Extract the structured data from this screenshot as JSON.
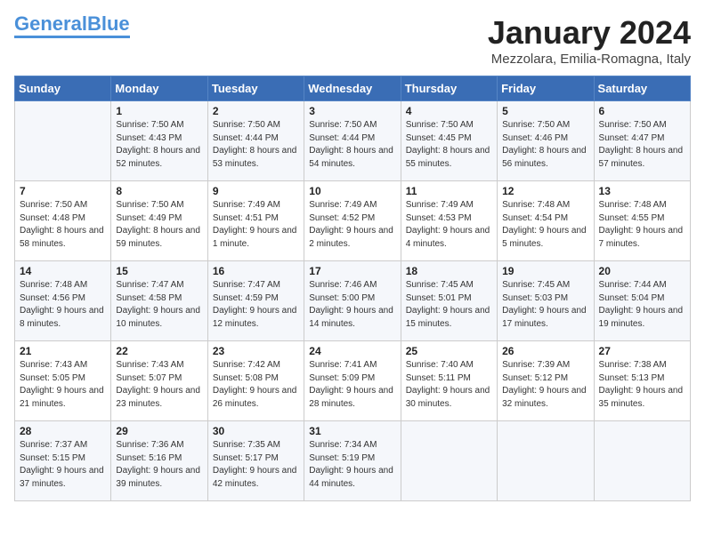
{
  "logo": {
    "part1": "General",
    "part2": "Blue"
  },
  "title": "January 2024",
  "location": "Mezzolara, Emilia-Romagna, Italy",
  "weekdays": [
    "Sunday",
    "Monday",
    "Tuesday",
    "Wednesday",
    "Thursday",
    "Friday",
    "Saturday"
  ],
  "weeks": [
    [
      {
        "day": "",
        "sunrise": "",
        "sunset": "",
        "daylight": ""
      },
      {
        "day": "1",
        "sunrise": "Sunrise: 7:50 AM",
        "sunset": "Sunset: 4:43 PM",
        "daylight": "Daylight: 8 hours and 52 minutes."
      },
      {
        "day": "2",
        "sunrise": "Sunrise: 7:50 AM",
        "sunset": "Sunset: 4:44 PM",
        "daylight": "Daylight: 8 hours and 53 minutes."
      },
      {
        "day": "3",
        "sunrise": "Sunrise: 7:50 AM",
        "sunset": "Sunset: 4:44 PM",
        "daylight": "Daylight: 8 hours and 54 minutes."
      },
      {
        "day": "4",
        "sunrise": "Sunrise: 7:50 AM",
        "sunset": "Sunset: 4:45 PM",
        "daylight": "Daylight: 8 hours and 55 minutes."
      },
      {
        "day": "5",
        "sunrise": "Sunrise: 7:50 AM",
        "sunset": "Sunset: 4:46 PM",
        "daylight": "Daylight: 8 hours and 56 minutes."
      },
      {
        "day": "6",
        "sunrise": "Sunrise: 7:50 AM",
        "sunset": "Sunset: 4:47 PM",
        "daylight": "Daylight: 8 hours and 57 minutes."
      }
    ],
    [
      {
        "day": "7",
        "sunrise": "Sunrise: 7:50 AM",
        "sunset": "Sunset: 4:48 PM",
        "daylight": "Daylight: 8 hours and 58 minutes."
      },
      {
        "day": "8",
        "sunrise": "Sunrise: 7:50 AM",
        "sunset": "Sunset: 4:49 PM",
        "daylight": "Daylight: 8 hours and 59 minutes."
      },
      {
        "day": "9",
        "sunrise": "Sunrise: 7:49 AM",
        "sunset": "Sunset: 4:51 PM",
        "daylight": "Daylight: 9 hours and 1 minute."
      },
      {
        "day": "10",
        "sunrise": "Sunrise: 7:49 AM",
        "sunset": "Sunset: 4:52 PM",
        "daylight": "Daylight: 9 hours and 2 minutes."
      },
      {
        "day": "11",
        "sunrise": "Sunrise: 7:49 AM",
        "sunset": "Sunset: 4:53 PM",
        "daylight": "Daylight: 9 hours and 4 minutes."
      },
      {
        "day": "12",
        "sunrise": "Sunrise: 7:48 AM",
        "sunset": "Sunset: 4:54 PM",
        "daylight": "Daylight: 9 hours and 5 minutes."
      },
      {
        "day": "13",
        "sunrise": "Sunrise: 7:48 AM",
        "sunset": "Sunset: 4:55 PM",
        "daylight": "Daylight: 9 hours and 7 minutes."
      }
    ],
    [
      {
        "day": "14",
        "sunrise": "Sunrise: 7:48 AM",
        "sunset": "Sunset: 4:56 PM",
        "daylight": "Daylight: 9 hours and 8 minutes."
      },
      {
        "day": "15",
        "sunrise": "Sunrise: 7:47 AM",
        "sunset": "Sunset: 4:58 PM",
        "daylight": "Daylight: 9 hours and 10 minutes."
      },
      {
        "day": "16",
        "sunrise": "Sunrise: 7:47 AM",
        "sunset": "Sunset: 4:59 PM",
        "daylight": "Daylight: 9 hours and 12 minutes."
      },
      {
        "day": "17",
        "sunrise": "Sunrise: 7:46 AM",
        "sunset": "Sunset: 5:00 PM",
        "daylight": "Daylight: 9 hours and 14 minutes."
      },
      {
        "day": "18",
        "sunrise": "Sunrise: 7:45 AM",
        "sunset": "Sunset: 5:01 PM",
        "daylight": "Daylight: 9 hours and 15 minutes."
      },
      {
        "day": "19",
        "sunrise": "Sunrise: 7:45 AM",
        "sunset": "Sunset: 5:03 PM",
        "daylight": "Daylight: 9 hours and 17 minutes."
      },
      {
        "day": "20",
        "sunrise": "Sunrise: 7:44 AM",
        "sunset": "Sunset: 5:04 PM",
        "daylight": "Daylight: 9 hours and 19 minutes."
      }
    ],
    [
      {
        "day": "21",
        "sunrise": "Sunrise: 7:43 AM",
        "sunset": "Sunset: 5:05 PM",
        "daylight": "Daylight: 9 hours and 21 minutes."
      },
      {
        "day": "22",
        "sunrise": "Sunrise: 7:43 AM",
        "sunset": "Sunset: 5:07 PM",
        "daylight": "Daylight: 9 hours and 23 minutes."
      },
      {
        "day": "23",
        "sunrise": "Sunrise: 7:42 AM",
        "sunset": "Sunset: 5:08 PM",
        "daylight": "Daylight: 9 hours and 26 minutes."
      },
      {
        "day": "24",
        "sunrise": "Sunrise: 7:41 AM",
        "sunset": "Sunset: 5:09 PM",
        "daylight": "Daylight: 9 hours and 28 minutes."
      },
      {
        "day": "25",
        "sunrise": "Sunrise: 7:40 AM",
        "sunset": "Sunset: 5:11 PM",
        "daylight": "Daylight: 9 hours and 30 minutes."
      },
      {
        "day": "26",
        "sunrise": "Sunrise: 7:39 AM",
        "sunset": "Sunset: 5:12 PM",
        "daylight": "Daylight: 9 hours and 32 minutes."
      },
      {
        "day": "27",
        "sunrise": "Sunrise: 7:38 AM",
        "sunset": "Sunset: 5:13 PM",
        "daylight": "Daylight: 9 hours and 35 minutes."
      }
    ],
    [
      {
        "day": "28",
        "sunrise": "Sunrise: 7:37 AM",
        "sunset": "Sunset: 5:15 PM",
        "daylight": "Daylight: 9 hours and 37 minutes."
      },
      {
        "day": "29",
        "sunrise": "Sunrise: 7:36 AM",
        "sunset": "Sunset: 5:16 PM",
        "daylight": "Daylight: 9 hours and 39 minutes."
      },
      {
        "day": "30",
        "sunrise": "Sunrise: 7:35 AM",
        "sunset": "Sunset: 5:17 PM",
        "daylight": "Daylight: 9 hours and 42 minutes."
      },
      {
        "day": "31",
        "sunrise": "Sunrise: 7:34 AM",
        "sunset": "Sunset: 5:19 PM",
        "daylight": "Daylight: 9 hours and 44 minutes."
      },
      {
        "day": "",
        "sunrise": "",
        "sunset": "",
        "daylight": ""
      },
      {
        "day": "",
        "sunrise": "",
        "sunset": "",
        "daylight": ""
      },
      {
        "day": "",
        "sunrise": "",
        "sunset": "",
        "daylight": ""
      }
    ]
  ]
}
